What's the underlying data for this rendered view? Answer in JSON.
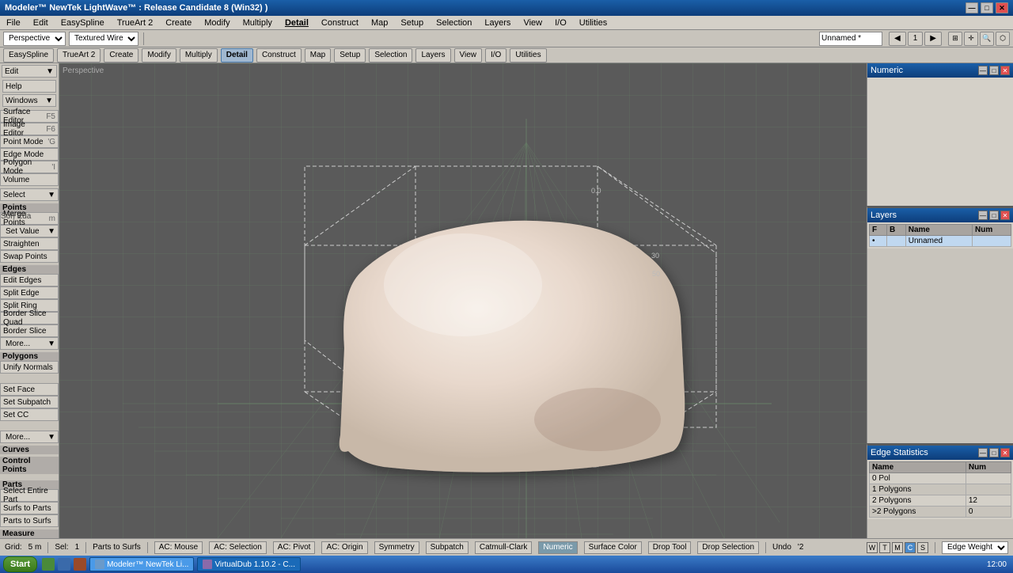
{
  "titlebar": {
    "title": "Modeler™ NewTek LightWave™ : Release Candidate 8 (Win32) )",
    "min": "—",
    "max": "□",
    "close": "✕"
  },
  "menubar": {
    "items": [
      "File",
      "Edit",
      "EasySpline",
      "TrueArt 2",
      "Create",
      "Modify",
      "Multiply",
      "Detail",
      "Construct",
      "Map",
      "Setup",
      "Selection",
      "Layers",
      "View",
      "I/O",
      "Utilities"
    ]
  },
  "toolbar": {
    "mode_options": [
      "Perspective",
      "Textured Wire"
    ],
    "view_label": "Perspective",
    "render_label": "Textured Wire",
    "scene_name": "Unnamed *"
  },
  "toolbar2": {
    "tabs": [
      "EasySpline",
      "TrueArt 2",
      "Create",
      "Modify",
      "Multiply",
      "Detail",
      "Construct",
      "Map",
      "Setup",
      "Selection",
      "Layers",
      "View",
      "I/O",
      "Utilities"
    ]
  },
  "left_panel": {
    "top_section": {
      "label_edit": "Edit",
      "label_help": "Help",
      "label_windows": "Windows",
      "items": [
        {
          "label": "Surface Editor",
          "shortcut": "F5"
        },
        {
          "label": "Image Editor",
          "shortcut": "F6"
        },
        {
          "label": "Point Mode",
          "shortcut": "'G"
        },
        {
          "label": "Edge Mode"
        },
        {
          "label": "Polygon Mode",
          "shortcut": "'I"
        },
        {
          "label": "Volume"
        },
        {
          "label": "Select"
        },
        {
          "label": "Points"
        },
        {
          "label": "Merge Points",
          "shortcut": "m"
        },
        {
          "label": "Set Value"
        },
        {
          "label": "Straighten"
        },
        {
          "label": "Swap Points"
        },
        {
          "label": "Edges"
        },
        {
          "label": "Edit Edges"
        },
        {
          "label": "Split Edge"
        },
        {
          "label": "Split Ring"
        },
        {
          "label": "Border Slice Quad"
        },
        {
          "label": "Border Slice"
        },
        {
          "label": "More..."
        },
        {
          "label": "Polygons"
        },
        {
          "label": "Unify Normals"
        },
        {
          "label": "Set Face"
        },
        {
          "label": "Set Subpatch"
        },
        {
          "label": "Set CC"
        },
        {
          "label": "More..."
        },
        {
          "label": "Curves"
        },
        {
          "label": "Control Points"
        },
        {
          "label": "Parts"
        },
        {
          "label": "Select Entire Part"
        },
        {
          "label": "Surfs to Parts"
        },
        {
          "label": "Parts to Surfs"
        },
        {
          "label": "Measure"
        },
        {
          "label": "Measure ▼"
        }
      ]
    }
  },
  "viewport": {
    "label": "Perspective",
    "bg_color": "#5a5a5a"
  },
  "numeric_panel": {
    "title": "Numeric",
    "min": "—",
    "max": "□",
    "close": "✕"
  },
  "layers_panel": {
    "title": "Layers",
    "columns": [
      "F",
      "B",
      "Name",
      "Num"
    ],
    "rows": [
      {
        "f": "",
        "b": "",
        "name": "Unnamed",
        "num": ""
      }
    ],
    "min": "—",
    "max": "□",
    "close": "✕"
  },
  "edge_stats_panel": {
    "title": "Edge Statistics",
    "columns": [
      "Name",
      "Num"
    ],
    "rows": [
      {
        "name": "0 Pol",
        "num": ""
      },
      {
        "name": "1 Polygons",
        "num": ""
      },
      {
        "name": "2 Polygons",
        "num": "12"
      },
      {
        "name": ">2 Polygons",
        "num": "0"
      }
    ],
    "min": "—",
    "max": "□",
    "close": "✕"
  },
  "statusbar": {
    "sel_label": "Sel:",
    "sel_value": "1",
    "parts_to_surfs": "Parts to Surfs",
    "grid_label": "Grid:",
    "grid_value": "5 m",
    "ac_mouse": "AC: Mouse",
    "ac_selection": "AC: Selection",
    "ac_pivot": "AC: Pivot",
    "ac_origin": "AC: Origin",
    "symmetry": "Symmetry",
    "subpatch": "Subpatch",
    "catmull_clark": "Catmull-Clark",
    "numeric": "Numeric",
    "surface_color": "Surface Color",
    "drop_tool": "Drop Tool",
    "drop_selection": "Drop Selection",
    "undo": "Undo",
    "undo_shortcut": "'2",
    "w": "W",
    "t": "T",
    "m_key": "M",
    "c_key": "C",
    "s_key": "S",
    "edge_weight": "Edge Weight"
  },
  "taskbar": {
    "start": "Start",
    "items": [
      {
        "label": "Modeler™ NewTek Li...",
        "active": true
      },
      {
        "label": "VirtualDub 1.10.2 - C...",
        "active": false
      }
    ]
  },
  "son_eda_label": "Son Eda"
}
